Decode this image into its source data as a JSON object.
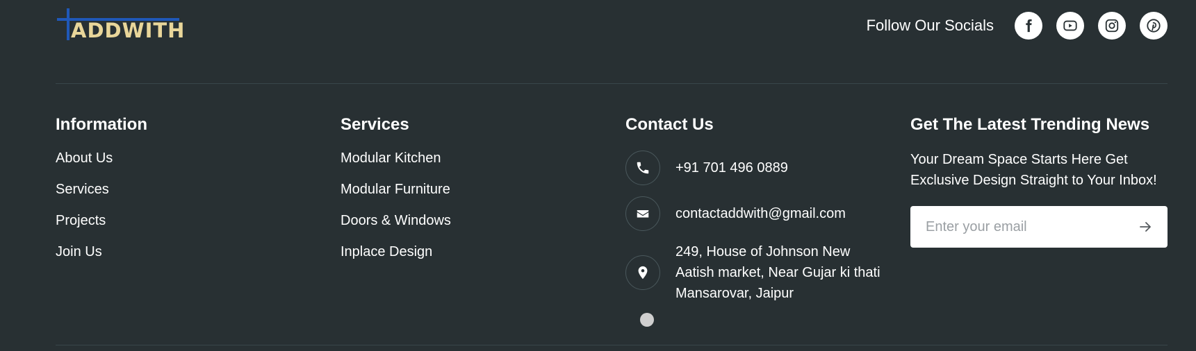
{
  "logo": {
    "text": "ADDWITH"
  },
  "socials": {
    "label": "Follow Our Socials",
    "icons": [
      "facebook-icon",
      "youtube-icon",
      "instagram-icon",
      "pinterest-icon"
    ]
  },
  "information": {
    "title": "Information",
    "links": [
      "About Us",
      "Services",
      "Projects",
      "Join Us"
    ]
  },
  "services": {
    "title": "Services",
    "links": [
      "Modular Kitchen",
      "Modular Furniture",
      "Doors & Windows",
      "Inplace Design"
    ]
  },
  "contact": {
    "title": "Contact Us",
    "phone": "+91 701 496 0889",
    "email": "contactaddwith@gmail.com",
    "address_line1": "249, House of Johnson New",
    "address_line2": "Aatish market, Near Gujar ki thati",
    "address_line3": "Mansarovar, Jaipur"
  },
  "newsletter": {
    "title": "Get The Latest Trending News",
    "text_line1": "Your Dream Space Starts Here Get",
    "text_line2": "Exclusive Design Straight to Your Inbox!",
    "placeholder": "Enter your email"
  },
  "colors": {
    "background": "#283033",
    "logo_text": "#e9d69a",
    "logo_accent": "#1f58b8",
    "text": "#ffffff"
  }
}
